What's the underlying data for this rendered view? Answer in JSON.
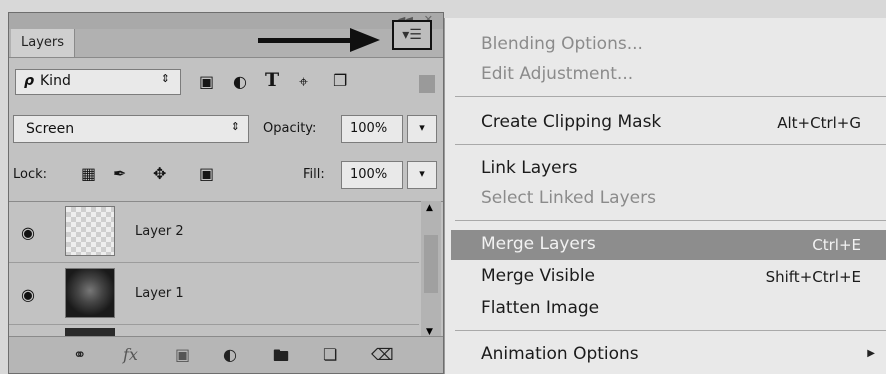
{
  "panel": {
    "tab_label": "Layers",
    "menu_button": "▾☰",
    "filter": {
      "kind_label": "Kind",
      "search_glyph": "ρ"
    },
    "blend_mode": "Screen",
    "opacity": {
      "label": "Opacity:",
      "value": "100%"
    },
    "lock_label": "Lock:",
    "fill": {
      "label": "Fill:",
      "value": "100%"
    },
    "layers": [
      {
        "name": "Layer 2"
      },
      {
        "name": "Layer 1"
      }
    ]
  },
  "menu": {
    "items": [
      {
        "label": "Blending Options...",
        "disabled": true
      },
      {
        "label": "Edit Adjustment...",
        "disabled": true
      },
      {
        "label": "Create Clipping Mask",
        "shortcut": "Alt+Ctrl+G"
      },
      {
        "label": "Link Layers"
      },
      {
        "label": "Select Linked Layers",
        "disabled": true
      },
      {
        "label": "Merge Layers",
        "shortcut": "Ctrl+E",
        "highlighted": true
      },
      {
        "label": "Merge Visible",
        "shortcut": "Shift+Ctrl+E"
      },
      {
        "label": "Flatten Image"
      },
      {
        "label": "Animation Options",
        "has_submenu": true
      }
    ]
  },
  "colors": {
    "panel_bg": "#c2c2c2",
    "menu_bg": "#e9e9e9",
    "highlight": "#8d8d8d",
    "disabled_text": "#8b8b8b",
    "arrow": "#101010"
  }
}
